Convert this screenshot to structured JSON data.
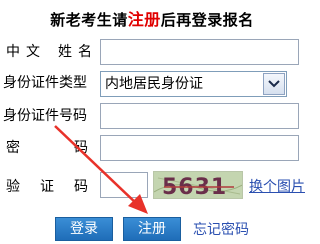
{
  "title": {
    "prefix": "新老考生请",
    "highlight": "注册",
    "suffix": "后再登录报名"
  },
  "form": {
    "name_label": [
      "中",
      "文",
      "姓",
      "名"
    ],
    "idtype_label": "身份证件类型",
    "idtype_value": "内地居民身份证",
    "idnum_label": "身份证件号码",
    "password_label": [
      "密",
      "码"
    ],
    "captcha_label": [
      "验",
      "证",
      "码"
    ],
    "captcha_text": "5631",
    "captcha_link": "换个图片"
  },
  "buttons": {
    "login": "登录",
    "register": "注册",
    "forgot": "忘记密码"
  },
  "colors": {
    "highlight": "#e00000",
    "button": "#1f6db8",
    "link": "#2a4fb0",
    "annotation": "#e8322a"
  }
}
